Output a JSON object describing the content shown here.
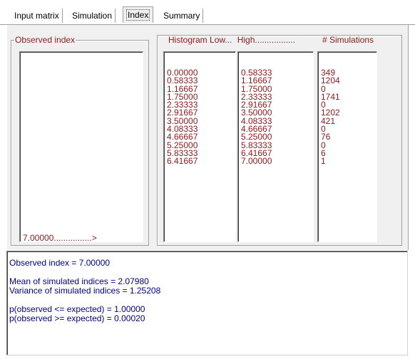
{
  "tabs": [
    {
      "label": "Input matrix",
      "active": false
    },
    {
      "label": "Simulation",
      "active": false
    },
    {
      "label": "Index",
      "active": true
    },
    {
      "label": "Summary",
      "active": false
    }
  ],
  "observed": {
    "legend": "Observed index",
    "marker_text": "7.00000................>"
  },
  "histogram": {
    "low_header": "Histogram Low...",
    "high_header": "High.................",
    "sims_header": "# Simulations",
    "low": [
      "0.00000",
      "0.58333",
      "1.16667",
      "1.75000",
      "2.33333",
      "2.91667",
      "3.50000",
      "4.08333",
      "4.66667",
      "5.25000",
      "5.83333",
      "6.41667"
    ],
    "high": [
      "0.58333",
      "1.16667",
      "1.75000",
      "2.33333",
      "2.91667",
      "3.50000",
      "4.08333",
      "4.66667",
      "5.25000",
      "5.83333",
      "6.41667",
      "7.00000"
    ],
    "sims": [
      "349",
      "1204",
      "0",
      "1741",
      "0",
      "1202",
      "421",
      "0",
      "76",
      "0",
      "6",
      "1"
    ]
  },
  "summary": {
    "observed_line": "Observed index = 7.00000",
    "mean_line": "Mean of simulated indices = 2.07980",
    "variance_line": "Variance of simulated indices = 1.25208",
    "p_le_line": "p(observed <= expected) = 1.00000",
    "p_ge_line": "p(observed >= expected) = 0.00020"
  },
  "colors": {
    "list_text": "#8b1a1a",
    "summary_text": "#000080",
    "panel_bg": "#f0f0f0"
  }
}
